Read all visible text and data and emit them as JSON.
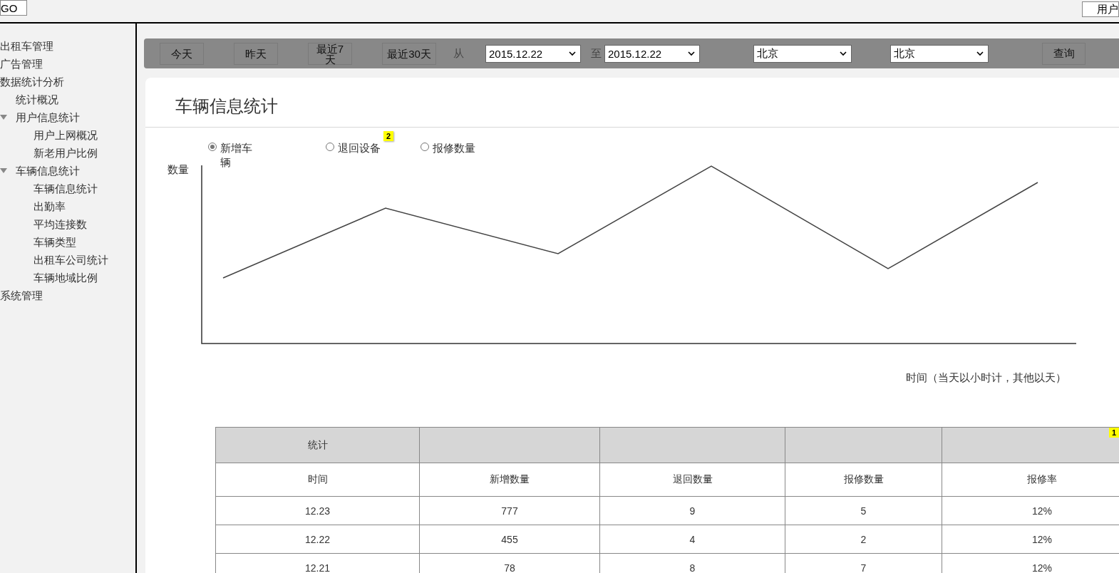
{
  "top_bar": {
    "go_button": "GO",
    "user_button": "用户"
  },
  "sidebar": {
    "items": [
      {
        "label": "出租车管理"
      },
      {
        "label": "广告管理"
      },
      {
        "label": "数据统计分析",
        "children": [
          {
            "label": "统计概况"
          },
          {
            "label": "用户信息统计",
            "expanded": true,
            "children": [
              {
                "label": "用户上网概况"
              },
              {
                "label": "新老用户比例"
              }
            ]
          },
          {
            "label": "车辆信息统计",
            "expanded": true,
            "children": [
              {
                "label": "车辆信息统计"
              },
              {
                "label": "出勤率"
              },
              {
                "label": "平均连接数"
              },
              {
                "label": "车辆类型"
              },
              {
                "label": "出租车公司统计"
              },
              {
                "label": "车辆地域比例"
              }
            ]
          }
        ]
      },
      {
        "label": "系统管理"
      }
    ]
  },
  "toolbar": {
    "quick_ranges": [
      {
        "label": "今天"
      },
      {
        "label": "昨天"
      },
      {
        "label": "最近7天"
      },
      {
        "label": "最近30天"
      }
    ],
    "from_label": "从",
    "from_date": "2015.12.22",
    "to_label": "至",
    "to_date": "2015.12.22",
    "region_1": "北京",
    "region_2": "北京",
    "query_button": "查询"
  },
  "card": {
    "title": "车辆信息统计",
    "metrics": [
      {
        "label": "新增车辆",
        "selected": true
      },
      {
        "label": "退回设备",
        "selected": false,
        "note_badge": "2"
      },
      {
        "label": "报修数量",
        "selected": false
      }
    ],
    "chart": {
      "ylabel": "数量",
      "xlabel": "时间（当天以小时计，其他以天）"
    },
    "table": {
      "group_header": "统计",
      "note_badge": "1",
      "columns": [
        "时间",
        "新增数量",
        "退回数量",
        "报修数量",
        "报修率"
      ],
      "rows": [
        [
          "12.23",
          "777",
          "9",
          "5",
          "12%"
        ],
        [
          "12.22",
          "455",
          "4",
          "2",
          "12%"
        ],
        [
          "12.21",
          "78",
          "8",
          "7",
          "12%"
        ]
      ]
    }
  }
}
